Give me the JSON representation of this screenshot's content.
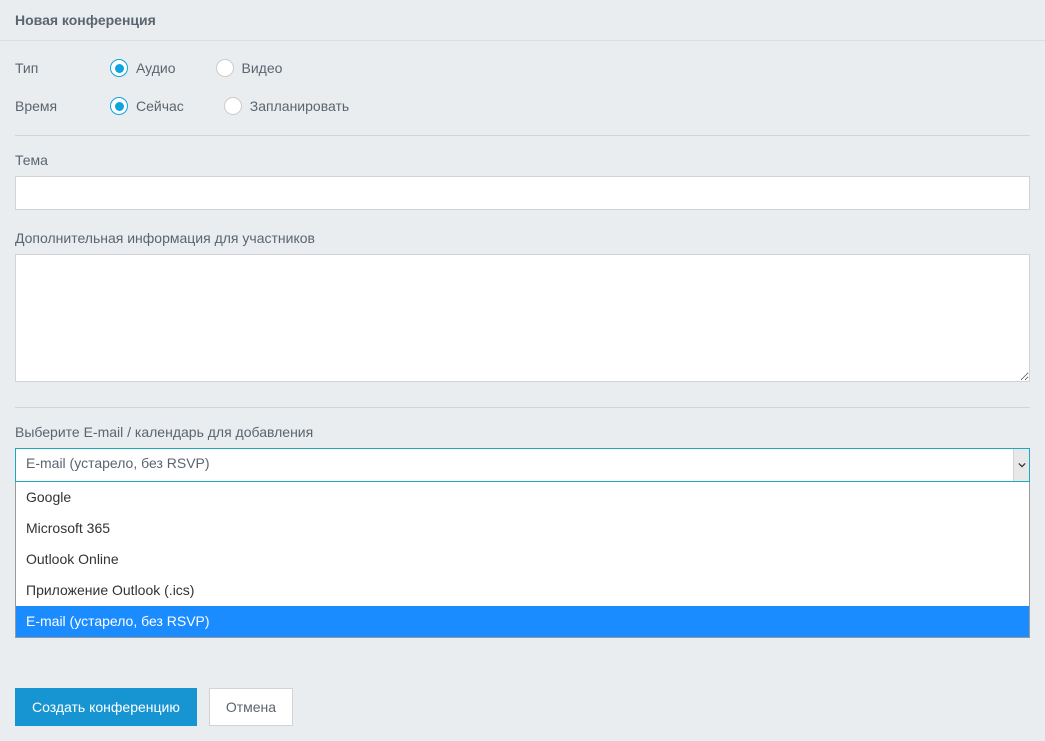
{
  "header": {
    "title": "Новая конференция"
  },
  "form": {
    "type": {
      "label": "Тип",
      "options": [
        {
          "label": "Аудио",
          "selected": true
        },
        {
          "label": "Видео",
          "selected": false
        }
      ]
    },
    "time": {
      "label": "Время",
      "options": [
        {
          "label": "Сейчас",
          "selected": true
        },
        {
          "label": "Запланировать",
          "selected": false
        }
      ]
    },
    "subject": {
      "label": "Тема",
      "value": ""
    },
    "info": {
      "label": "Дополнительная информация для участников",
      "value": ""
    },
    "calendar": {
      "label": "Выберите E-mail / календарь для добавления",
      "selected": "E-mail (устарело, без RSVP)",
      "options": [
        "Google",
        "Microsoft 365",
        "Outlook Online",
        "Приложение Outlook (.ics)",
        "E-mail (устарело, без RSVP)"
      ]
    }
  },
  "actions": {
    "create": "Создать конференцию",
    "cancel": "Отмена"
  }
}
